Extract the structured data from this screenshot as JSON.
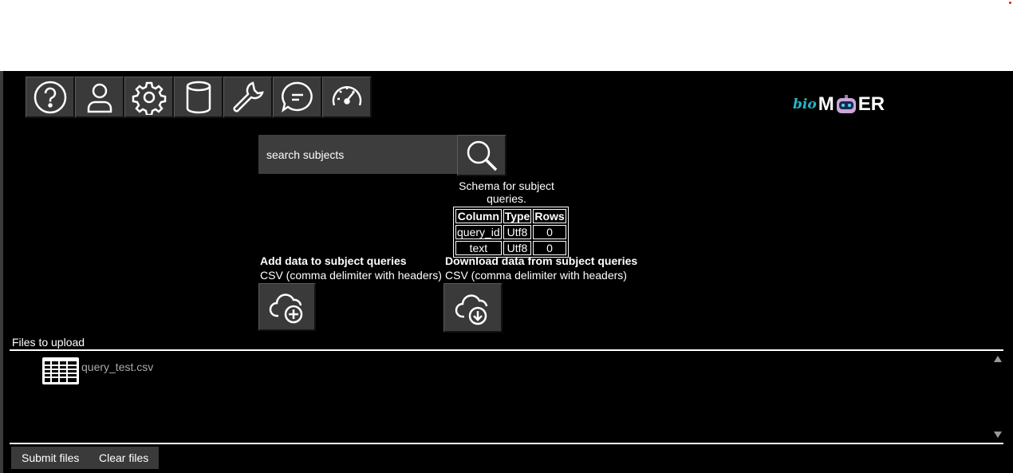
{
  "toolbar": {
    "buttons": [
      {
        "icon": "help-icon"
      },
      {
        "icon": "user-icon"
      },
      {
        "icon": "gear-icon"
      },
      {
        "icon": "database-icon"
      },
      {
        "icon": "wrench-icon"
      },
      {
        "icon": "chat-icon"
      },
      {
        "icon": "gauge-icon"
      }
    ]
  },
  "logo": {
    "prefix": "bio",
    "part1": "M",
    "part2": "ER",
    "prefix_color": "#26b5c6"
  },
  "search": {
    "placeholder": "search subjects",
    "button_icon": "search-icon"
  },
  "schema": {
    "caption": "Schema for subject queries.",
    "headers": [
      "Column",
      "Type",
      "Rows"
    ],
    "rows": [
      [
        "query_id",
        "Utf8",
        "0"
      ],
      [
        "text",
        "Utf8",
        "0"
      ]
    ]
  },
  "add": {
    "title": "Add data to subject queries",
    "subtitle": "CSV (comma delimiter with headers)",
    "icon": "cloud-upload-icon"
  },
  "download": {
    "title": "Download data from subject queries",
    "subtitle": "CSV (comma delimiter with headers)",
    "icon": "cloud-download-icon"
  },
  "files": {
    "label": "Files to upload",
    "items": [
      {
        "name": "query_test.csv",
        "icon": "table-file-icon"
      }
    ]
  },
  "actions": {
    "submit_label": "Submit files",
    "clear_label": "Clear files"
  },
  "colors": {
    "background": "#000000",
    "button": "#3a3a3a",
    "accent_dot": "#dd1111"
  }
}
